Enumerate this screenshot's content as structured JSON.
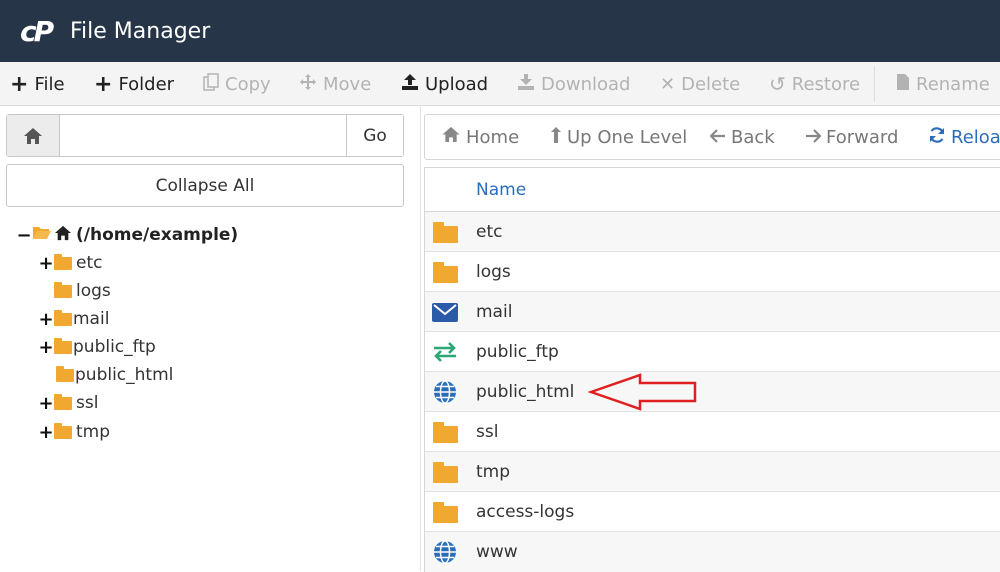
{
  "header": {
    "logo": "cP",
    "title": "File Manager"
  },
  "toolbar": {
    "file": "File",
    "folder": "Folder",
    "copy": "Copy",
    "move": "Move",
    "upload": "Upload",
    "download": "Download",
    "delete": "Delete",
    "restore": "Restore",
    "rename": "Rename"
  },
  "left": {
    "path_value": "",
    "go": "Go",
    "collapse_all": "Collapse All",
    "tree": {
      "root": "(/home/example)",
      "items": [
        "etc",
        "logs",
        "mail",
        "public_ftp",
        "public_html",
        "ssl",
        "tmp"
      ]
    }
  },
  "nav": {
    "home": "Home",
    "up": "Up One Level",
    "back": "Back",
    "forward": "Forward",
    "reload": "Reloa"
  },
  "table": {
    "header_name": "Name",
    "rows": [
      "etc",
      "logs",
      "mail",
      "public_ftp",
      "public_html",
      "ssl",
      "tmp",
      "access-logs",
      "www"
    ],
    "row_icons": [
      "folder-icon",
      "folder-icon",
      "mail-icon",
      "transfer-icon",
      "globe-icon",
      "folder-icon",
      "folder-icon",
      "folder-icon",
      "globe-icon"
    ]
  },
  "colors": {
    "header_bg": "#263648",
    "folder": "#f0a830",
    "link_blue": "#2a6ebb",
    "mail_icon": "#2a5aa8",
    "transfer_icon": "#2aa878",
    "annotation_arrow": "#e02020"
  }
}
